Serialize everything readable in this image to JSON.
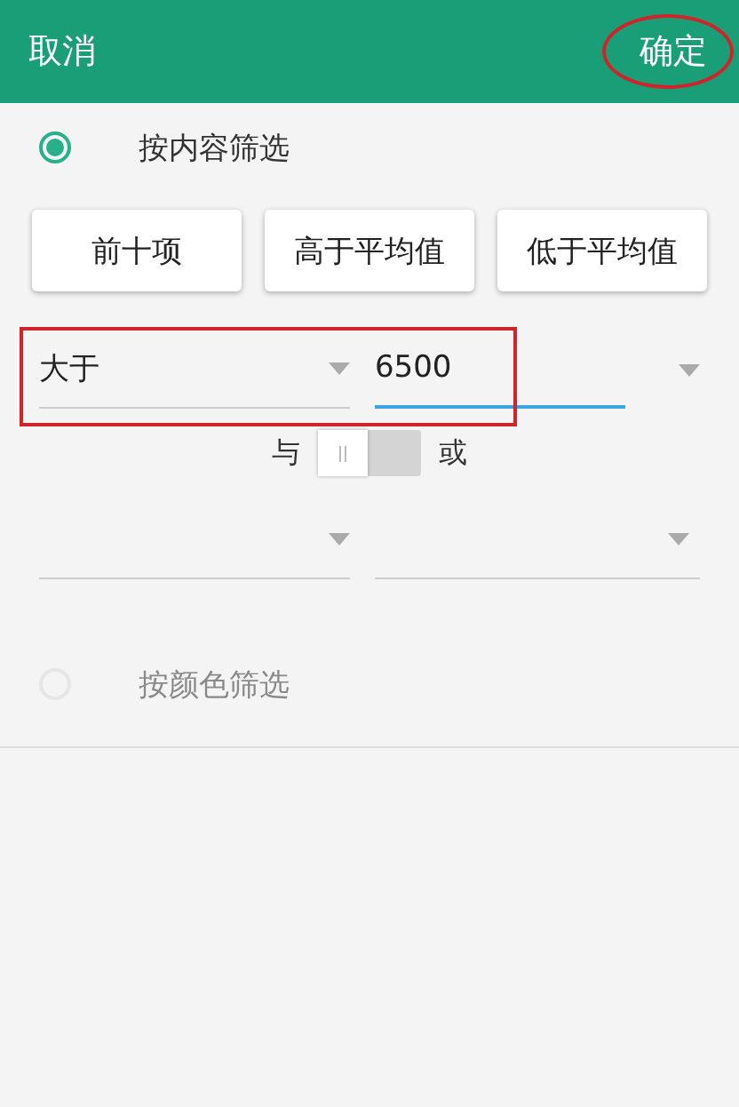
{
  "header": {
    "cancel": "取消",
    "confirm": "确定"
  },
  "content_filter": {
    "label": "按内容筛选",
    "selected": true
  },
  "quick_buttons": [
    "前十项",
    "高于平均值",
    "低于平均值"
  ],
  "condition": {
    "operator": "大于",
    "value": "6500"
  },
  "logic": {
    "and_label": "与",
    "or_label": "或",
    "on": false
  },
  "color_filter": {
    "label": "按颜色筛选",
    "selected": false,
    "disabled": true
  }
}
